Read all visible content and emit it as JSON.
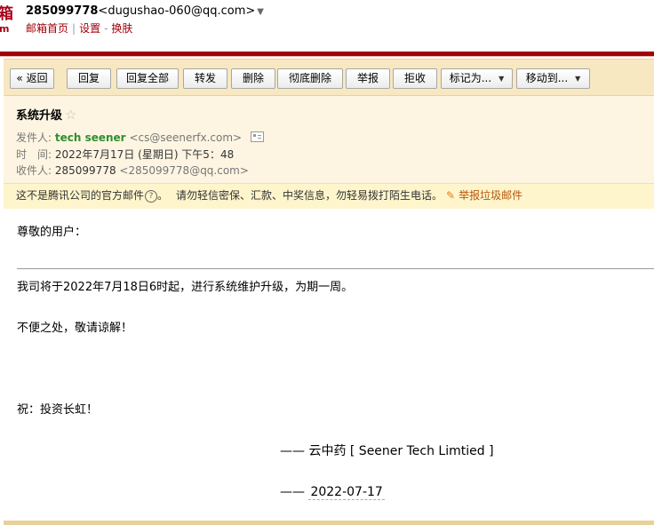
{
  "top": {
    "logo_fragment_1": "箱",
    "logo_fragment_2": "m",
    "account_number": "285099778",
    "account_email": "<dugushao-060@qq.com>",
    "account_caret": "▼",
    "links": [
      "邮箱首页",
      "设置",
      "换肤"
    ]
  },
  "toolbar": {
    "back": "« 返回",
    "reply": "回复",
    "reply_all": "回复全部",
    "forward": "转发",
    "delete": "删除",
    "delete_forever": "彻底删除",
    "report": "举报",
    "reject": "拒收",
    "mark_as": "标记为...",
    "move_to": "移动到..."
  },
  "header": {
    "subject": "系统升级",
    "star": "☆",
    "from_label": "发件人:",
    "from_name": "tech seener",
    "from_email": "<cs@seenerfx.com>",
    "time_label": "时　间:",
    "time_value": "2022年7月17日 (星期日) 下午5：48",
    "to_label": "收件人:",
    "to_name": "285099778",
    "to_email": "<285099778@qq.com>"
  },
  "warning": {
    "not_official": "这不是腾讯公司的官方邮件",
    "help_mark": "?",
    "period": "。",
    "advice": "请勿轻信密保、汇款、中奖信息，勿轻易拨打陌生电话。",
    "report_spam": "举报垃圾邮件"
  },
  "body": {
    "greeting": "尊敬的用户：",
    "line1": "我司将于2022年7月18日6时起，进行系统维护升级，为期一周。",
    "line2": "不便之处，敬请谅解！",
    "line3": "祝：投资长虹！",
    "sig_company": "—— 云中药 [ Seener Tech Limtied ]",
    "sig_dash": "——",
    "sig_date": "2022-07-17"
  }
}
